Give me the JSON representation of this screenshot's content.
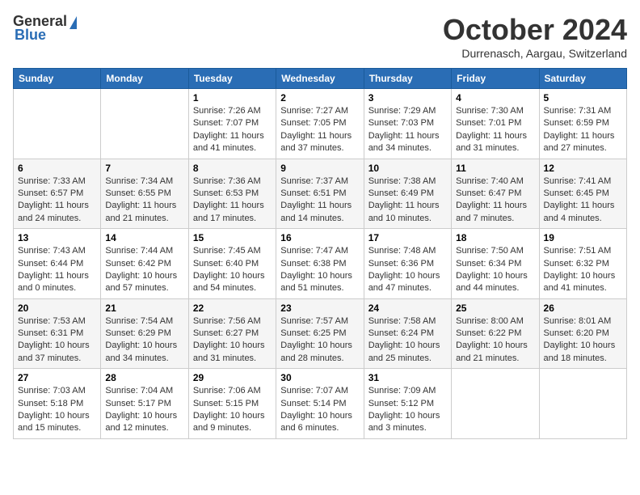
{
  "logo": {
    "general": "General",
    "blue": "Blue"
  },
  "header": {
    "month": "October 2024",
    "location": "Durrenasch, Aargau, Switzerland"
  },
  "weekdays": [
    "Sunday",
    "Monday",
    "Tuesday",
    "Wednesday",
    "Thursday",
    "Friday",
    "Saturday"
  ],
  "weeks": [
    [
      null,
      null,
      {
        "day": "1",
        "sunrise": "Sunrise: 7:26 AM",
        "sunset": "Sunset: 7:07 PM",
        "daylight": "Daylight: 11 hours and 41 minutes."
      },
      {
        "day": "2",
        "sunrise": "Sunrise: 7:27 AM",
        "sunset": "Sunset: 7:05 PM",
        "daylight": "Daylight: 11 hours and 37 minutes."
      },
      {
        "day": "3",
        "sunrise": "Sunrise: 7:29 AM",
        "sunset": "Sunset: 7:03 PM",
        "daylight": "Daylight: 11 hours and 34 minutes."
      },
      {
        "day": "4",
        "sunrise": "Sunrise: 7:30 AM",
        "sunset": "Sunset: 7:01 PM",
        "daylight": "Daylight: 11 hours and 31 minutes."
      },
      {
        "day": "5",
        "sunrise": "Sunrise: 7:31 AM",
        "sunset": "Sunset: 6:59 PM",
        "daylight": "Daylight: 11 hours and 27 minutes."
      }
    ],
    [
      {
        "day": "6",
        "sunrise": "Sunrise: 7:33 AM",
        "sunset": "Sunset: 6:57 PM",
        "daylight": "Daylight: 11 hours and 24 minutes."
      },
      {
        "day": "7",
        "sunrise": "Sunrise: 7:34 AM",
        "sunset": "Sunset: 6:55 PM",
        "daylight": "Daylight: 11 hours and 21 minutes."
      },
      {
        "day": "8",
        "sunrise": "Sunrise: 7:36 AM",
        "sunset": "Sunset: 6:53 PM",
        "daylight": "Daylight: 11 hours and 17 minutes."
      },
      {
        "day": "9",
        "sunrise": "Sunrise: 7:37 AM",
        "sunset": "Sunset: 6:51 PM",
        "daylight": "Daylight: 11 hours and 14 minutes."
      },
      {
        "day": "10",
        "sunrise": "Sunrise: 7:38 AM",
        "sunset": "Sunset: 6:49 PM",
        "daylight": "Daylight: 11 hours and 10 minutes."
      },
      {
        "day": "11",
        "sunrise": "Sunrise: 7:40 AM",
        "sunset": "Sunset: 6:47 PM",
        "daylight": "Daylight: 11 hours and 7 minutes."
      },
      {
        "day": "12",
        "sunrise": "Sunrise: 7:41 AM",
        "sunset": "Sunset: 6:45 PM",
        "daylight": "Daylight: 11 hours and 4 minutes."
      }
    ],
    [
      {
        "day": "13",
        "sunrise": "Sunrise: 7:43 AM",
        "sunset": "Sunset: 6:44 PM",
        "daylight": "Daylight: 11 hours and 0 minutes."
      },
      {
        "day": "14",
        "sunrise": "Sunrise: 7:44 AM",
        "sunset": "Sunset: 6:42 PM",
        "daylight": "Daylight: 10 hours and 57 minutes."
      },
      {
        "day": "15",
        "sunrise": "Sunrise: 7:45 AM",
        "sunset": "Sunset: 6:40 PM",
        "daylight": "Daylight: 10 hours and 54 minutes."
      },
      {
        "day": "16",
        "sunrise": "Sunrise: 7:47 AM",
        "sunset": "Sunset: 6:38 PM",
        "daylight": "Daylight: 10 hours and 51 minutes."
      },
      {
        "day": "17",
        "sunrise": "Sunrise: 7:48 AM",
        "sunset": "Sunset: 6:36 PM",
        "daylight": "Daylight: 10 hours and 47 minutes."
      },
      {
        "day": "18",
        "sunrise": "Sunrise: 7:50 AM",
        "sunset": "Sunset: 6:34 PM",
        "daylight": "Daylight: 10 hours and 44 minutes."
      },
      {
        "day": "19",
        "sunrise": "Sunrise: 7:51 AM",
        "sunset": "Sunset: 6:32 PM",
        "daylight": "Daylight: 10 hours and 41 minutes."
      }
    ],
    [
      {
        "day": "20",
        "sunrise": "Sunrise: 7:53 AM",
        "sunset": "Sunset: 6:31 PM",
        "daylight": "Daylight: 10 hours and 37 minutes."
      },
      {
        "day": "21",
        "sunrise": "Sunrise: 7:54 AM",
        "sunset": "Sunset: 6:29 PM",
        "daylight": "Daylight: 10 hours and 34 minutes."
      },
      {
        "day": "22",
        "sunrise": "Sunrise: 7:56 AM",
        "sunset": "Sunset: 6:27 PM",
        "daylight": "Daylight: 10 hours and 31 minutes."
      },
      {
        "day": "23",
        "sunrise": "Sunrise: 7:57 AM",
        "sunset": "Sunset: 6:25 PM",
        "daylight": "Daylight: 10 hours and 28 minutes."
      },
      {
        "day": "24",
        "sunrise": "Sunrise: 7:58 AM",
        "sunset": "Sunset: 6:24 PM",
        "daylight": "Daylight: 10 hours and 25 minutes."
      },
      {
        "day": "25",
        "sunrise": "Sunrise: 8:00 AM",
        "sunset": "Sunset: 6:22 PM",
        "daylight": "Daylight: 10 hours and 21 minutes."
      },
      {
        "day": "26",
        "sunrise": "Sunrise: 8:01 AM",
        "sunset": "Sunset: 6:20 PM",
        "daylight": "Daylight: 10 hours and 18 minutes."
      }
    ],
    [
      {
        "day": "27",
        "sunrise": "Sunrise: 7:03 AM",
        "sunset": "Sunset: 5:18 PM",
        "daylight": "Daylight: 10 hours and 15 minutes."
      },
      {
        "day": "28",
        "sunrise": "Sunrise: 7:04 AM",
        "sunset": "Sunset: 5:17 PM",
        "daylight": "Daylight: 10 hours and 12 minutes."
      },
      {
        "day": "29",
        "sunrise": "Sunrise: 7:06 AM",
        "sunset": "Sunset: 5:15 PM",
        "daylight": "Daylight: 10 hours and 9 minutes."
      },
      {
        "day": "30",
        "sunrise": "Sunrise: 7:07 AM",
        "sunset": "Sunset: 5:14 PM",
        "daylight": "Daylight: 10 hours and 6 minutes."
      },
      {
        "day": "31",
        "sunrise": "Sunrise: 7:09 AM",
        "sunset": "Sunset: 5:12 PM",
        "daylight": "Daylight: 10 hours and 3 minutes."
      },
      null,
      null
    ]
  ]
}
